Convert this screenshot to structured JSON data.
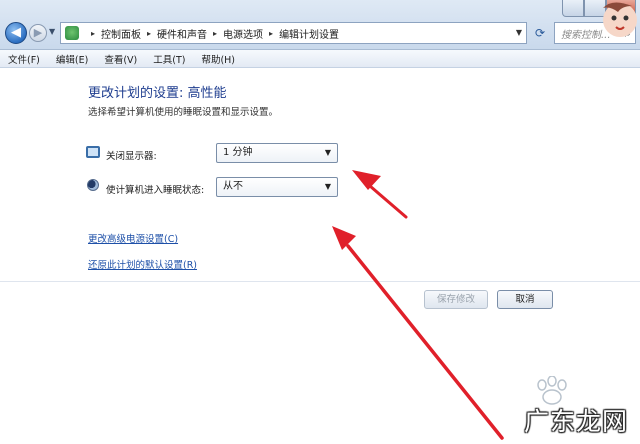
{
  "address_bar": {
    "breadcrumbs": [
      "控制面板",
      "硬件和声音",
      "电源选项",
      "编辑计划设置"
    ],
    "search_placeholder": "搜索控制..."
  },
  "menu": [
    "文件(F)",
    "编辑(E)",
    "查看(V)",
    "工具(T)",
    "帮助(H)"
  ],
  "main": {
    "title": "更改计划的设置: 高性能",
    "description": "选择希望计算机使用的睡眠设置和显示设置。",
    "settings": [
      {
        "icon": "monitor-icon",
        "label": "关闭显示器:",
        "value": "1 分钟"
      },
      {
        "icon": "moon-icon",
        "label": "使计算机进入睡眠状态:",
        "value": "从不"
      }
    ],
    "links": [
      "更改高级电源设置(C)",
      "还原此计划的默认设置(R)"
    ],
    "buttons": {
      "save": "保存修改",
      "cancel": "取消"
    }
  },
  "watermark": {
    "text": "广东龙网"
  },
  "colors": {
    "title": "#1e3d8f",
    "link": "#1e50a8",
    "arrow": "#e0202a"
  }
}
